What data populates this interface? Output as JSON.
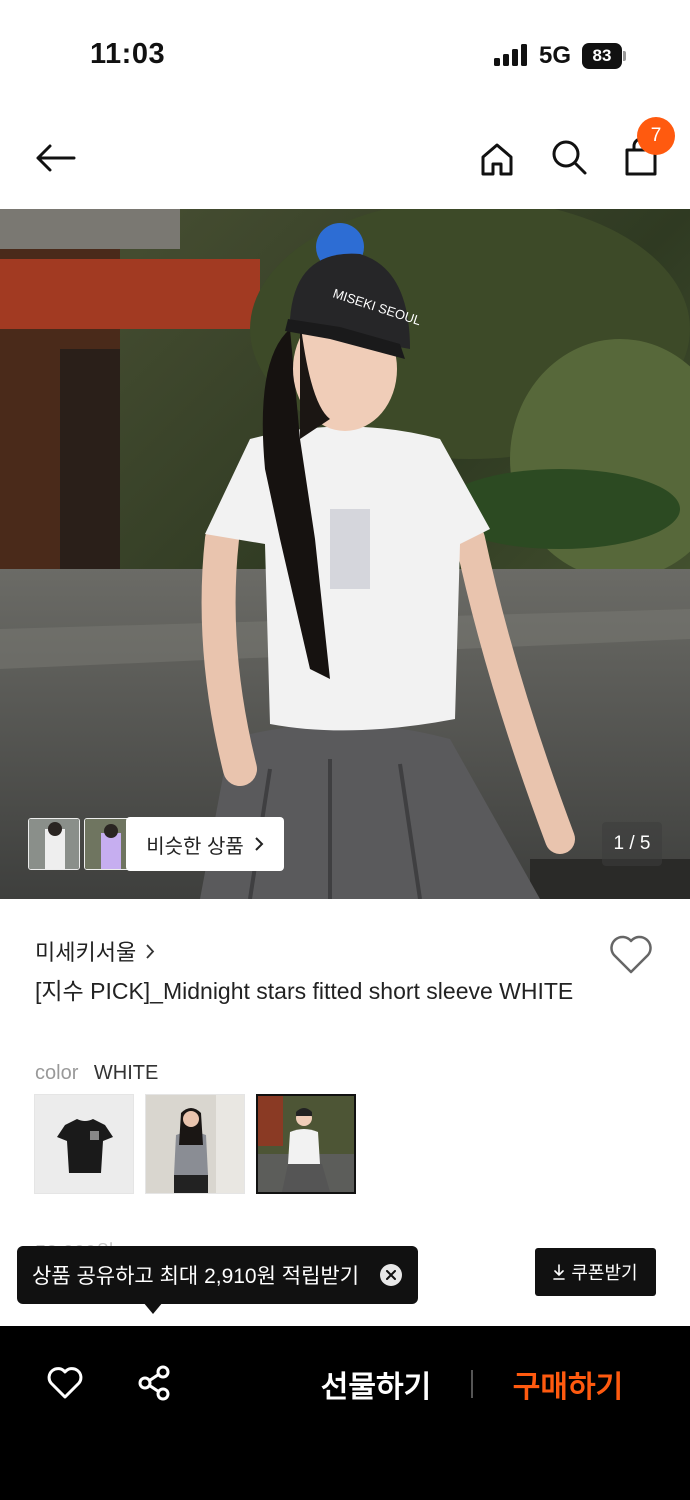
{
  "status_bar": {
    "time": "11:03",
    "network": "5G",
    "battery": "83"
  },
  "header": {
    "cart_count": "7",
    "icons": [
      "back-arrow-icon",
      "home-icon",
      "search-icon",
      "shopping-bag-icon"
    ]
  },
  "hero": {
    "similar_label": "비슷한 상품",
    "page_counter": "1 / 5",
    "cap_text": "MISEKI SEOUL"
  },
  "product": {
    "brand": "미세키서울",
    "title": "[지수 PICK]_Midnight stars fitted short sleeve WHITE",
    "color_label": "color",
    "color_value": "WHITE",
    "price_partial": "52,000원"
  },
  "tooltip": {
    "text": "상품 공유하고 최대 2,910원 적립받기"
  },
  "coupon": {
    "label": "쿠폰받기"
  },
  "bottom_bar": {
    "gift_label": "선물하기",
    "buy_label": "구매하기"
  },
  "colors": {
    "accent": "#ff5a0f",
    "bar": "#000000"
  }
}
